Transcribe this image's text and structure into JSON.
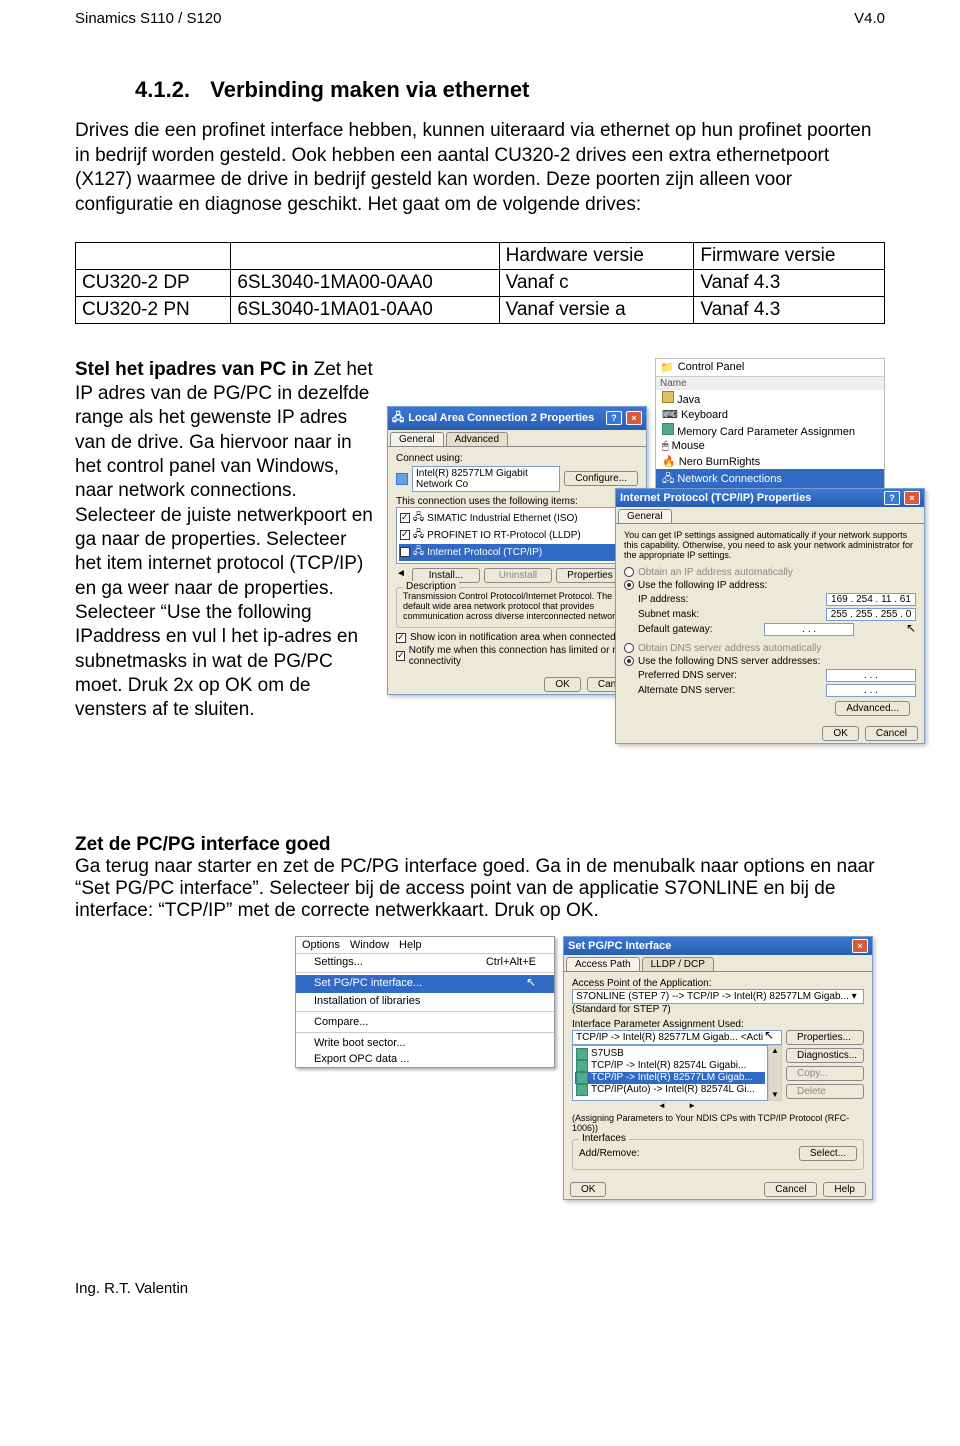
{
  "header": {
    "left": "Sinamics S110 / S120",
    "right": "V4.0"
  },
  "section": {
    "number": "4.1.2.",
    "title": "Verbinding maken via ethernet"
  },
  "intro": "Drives die een profinet interface hebben, kunnen uiteraard via ethernet op hun profinet poorten in bedrijf worden gesteld. Ook hebben een aantal CU320-2 drives een extra ethernetpoort (X127) waarmee de drive in bedrijf gesteld kan worden. Deze poorten zijn alleen voor configuratie en diagnose geschikt. Het gaat om de volgende drives:",
  "drives_table": {
    "headers": [
      "",
      "",
      "Hardware versie",
      "Firmware versie"
    ],
    "rows": [
      [
        "CU320-2 DP",
        "6SL3040-1MA00-0AA0",
        "Vanaf c",
        "Vanaf 4.3"
      ],
      [
        "CU320-2 PN",
        "6SL3040-1MA01-0AA0",
        "Vanaf versie a",
        "Vanaf 4.3"
      ]
    ]
  },
  "ip_section": {
    "title": "Stel het ipadres van PC in",
    "body": "Zet het IP adres van de PG/PC in dezelfde range als het gewenste IP adres van de drive.  Ga hiervoor naar in het control panel van Windows, naar network connections. Selecteer de juiste netwerkpoort en ga naar de properties. Selecteer het item internet protocol (TCP/IP) en ga weer naar de properties. Selecteer “Use the following IPaddress en vul l het ip-adres en subnetmasks in wat de PG/PC moet. Druk 2x op OK om de vensters af te sluiten."
  },
  "control_panel": {
    "breadcrumb": "Control Panel",
    "col_name": "Name",
    "items": [
      "Java",
      "Keyboard",
      "Memory Card Parameter Assignmen",
      "Mouse",
      "Nero BurnRights",
      "Network Connections"
    ],
    "selected_index": 5
  },
  "lac_props": {
    "title": "Local Area Connection 2 Properties",
    "tabs": [
      "General",
      "Advanced"
    ],
    "connect_using_label": "Connect using:",
    "adapter": "Intel(R) 82577LM Gigabit Network Co",
    "configure": "Configure...",
    "items_label": "This connection uses the following items:",
    "items": [
      "SIMATIC Industrial Ethernet (ISO)",
      "PROFINET IO RT-Protocol (LLDP)",
      "Internet Protocol (TCP/IP)"
    ],
    "install": "Install...",
    "uninstall": "Uninstall",
    "properties": "Properties",
    "desc_header": "Description",
    "desc": "Transmission Control Protocol/Internet Protocol. The default wide area network protocol that provides communication across diverse interconnected networks.",
    "show_icon": "Show icon in notification area when connected",
    "notify": "Notify me when this connection has limited or no connectivity",
    "ok": "OK",
    "cancel": "Cancel"
  },
  "tcpip": {
    "title": "Internet Protocol (TCP/IP) Properties",
    "tab": "General",
    "blurb": "You can get IP settings assigned automatically if your network supports this capability. Otherwise, you need to ask your network administrator for the appropriate IP settings.",
    "obtain_auto": "Obtain an IP address automatically",
    "use_following": "Use the following IP address:",
    "ip_label": "IP address:",
    "ip": "169 . 254 . 11 . 61",
    "mask_label": "Subnet mask:",
    "mask": "255 . 255 . 255 . 0",
    "gw_label": "Default gateway:",
    "gw": ". . .",
    "obtain_dns": "Obtain DNS server address automatically",
    "use_dns": "Use the following DNS server addresses:",
    "pref_dns": "Preferred DNS server:",
    "pref_val": ". . .",
    "alt_dns": "Alternate DNS server:",
    "alt_val": ". . .",
    "advanced": "Advanced...",
    "ok": "OK",
    "cancel": "Cancel"
  },
  "pgpc_section": {
    "title": "Zet de PC/PG interface goed",
    "body": "Ga terug naar starter en zet de PC/PG interface goed. Ga in de menubalk naar options en naar “Set PG/PC interface”.  Selecteer bij de access point van de applicatie S7ONLINE en bij de interface: “TCP/IP” met de correcte netwerkkaart. Druk op OK."
  },
  "options_menu": {
    "bar": [
      "Options",
      "Window",
      "Help"
    ],
    "items": [
      "Settings...",
      "Set PG/PC interface...",
      "Installation of libraries",
      "Compare...",
      "Write boot sector...",
      "Export OPC data ..."
    ],
    "shortcut_for_settings": "Ctrl+Alt+E",
    "selected_index": 1
  },
  "pgpc_dialog": {
    "title": "Set PG/PC Interface",
    "tabs": [
      "Access Path",
      "LLDP / DCP"
    ],
    "ap_label": "Access Point of the Application:",
    "ap_value": "S7ONLINE    (STEP 7)    --> TCP/IP -> Intel(R) 82577LM Gigab...",
    "standard": "(Standard for STEP 7)",
    "ipau_label": "Interface Parameter Assignment Used:",
    "ipau_value": "TCP/IP -> Intel(R) 82577LM Gigab... <Acti",
    "list": [
      "S7USB",
      "TCP/IP -> Intel(R) 82574L Gigabi...",
      "TCP/IP -> Intel(R) 82577LM Gigab...",
      "TCP/IP(Auto) -> Intel(R) 82574L Gi..."
    ],
    "props": "Properties...",
    "diag": "Diagnostics...",
    "copy": "Copy...",
    "delete": "Delete",
    "assign": "(Assigning Parameters to Your NDIS CPs with TCP/IP Protocol (RFC-1006))",
    "interfaces": "Interfaces",
    "addremove": "Add/Remove:",
    "select": "Select...",
    "ok": "OK",
    "cancel": "Cancel",
    "help": "Help"
  },
  "footer": "Ing. R.T. Valentin"
}
